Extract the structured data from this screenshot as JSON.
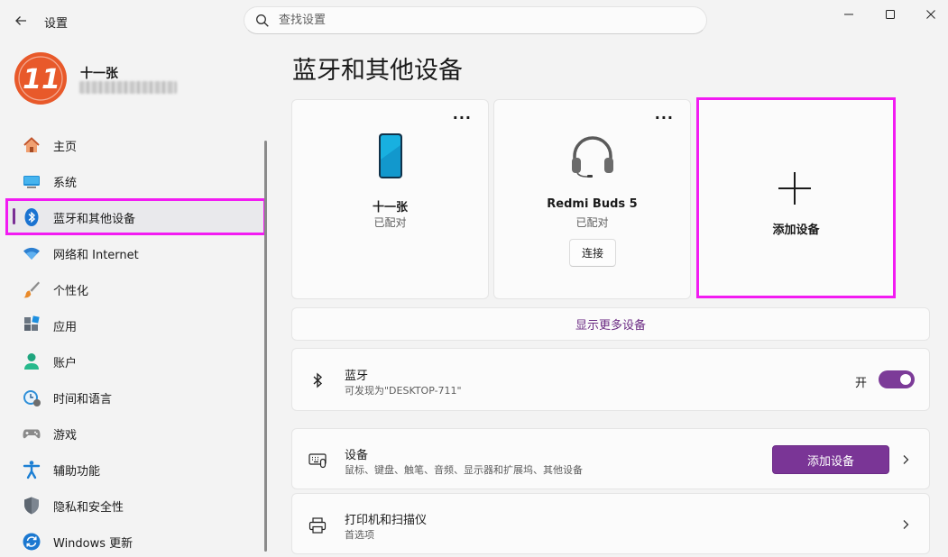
{
  "window": {
    "title": "设置",
    "search_placeholder": "查找设置"
  },
  "profile": {
    "name": "十一张",
    "avatar_text": "11"
  },
  "nav": {
    "items": [
      {
        "label": "主页",
        "icon": "home-icon"
      },
      {
        "label": "系统",
        "icon": "system-icon"
      },
      {
        "label": "蓝牙和其他设备",
        "icon": "bluetooth-icon"
      },
      {
        "label": "网络和 Internet",
        "icon": "wifi-icon"
      },
      {
        "label": "个性化",
        "icon": "brush-icon"
      },
      {
        "label": "应用",
        "icon": "apps-icon"
      },
      {
        "label": "账户",
        "icon": "account-icon"
      },
      {
        "label": "时间和语言",
        "icon": "time-language-icon"
      },
      {
        "label": "游戏",
        "icon": "gamepad-icon"
      },
      {
        "label": "辅助功能",
        "icon": "accessibility-icon"
      },
      {
        "label": "隐私和安全性",
        "icon": "shield-icon"
      },
      {
        "label": "Windows 更新",
        "icon": "update-icon"
      }
    ],
    "active_index": 2
  },
  "main": {
    "title": "蓝牙和其他设备",
    "devices": [
      {
        "name": "十一张",
        "status": "已配对",
        "icon": "phone-icon",
        "more": "···"
      },
      {
        "name": "Redmi Buds 5",
        "status": "已配对",
        "icon": "headphones-icon",
        "more": "···",
        "action": "连接"
      }
    ],
    "add_device_card": {
      "label": "添加设备",
      "icon": "plus-icon"
    },
    "show_more": "显示更多设备",
    "bluetooth": {
      "title": "蓝牙",
      "subtitle": "可发现为\"DESKTOP-711\"",
      "toggle_label": "开",
      "toggle_on": true
    },
    "devices_row": {
      "title": "设备",
      "subtitle": "鼠标、键盘、触笔、音频、显示器和扩展坞、其他设备",
      "button": "添加设备"
    },
    "printers_row": {
      "title": "打印机和扫描仪",
      "subtitle": "首选项"
    }
  },
  "colors": {
    "accent": "#7a3596",
    "highlight_box": "#f21bf2",
    "link": "#6b2a83",
    "background": "#f3f3f3",
    "card": "#fbfbfb"
  }
}
